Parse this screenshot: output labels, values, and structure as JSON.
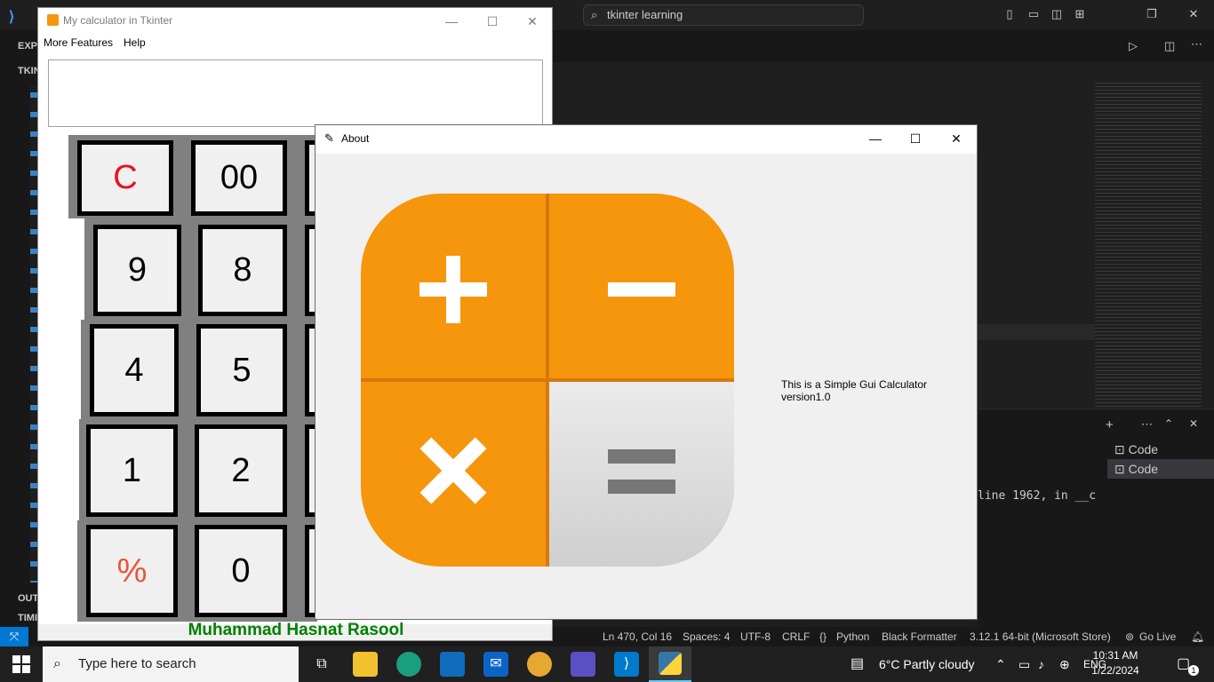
{
  "vscode": {
    "search_text": "tkinter learning",
    "sidebar_labels": [
      "EXPL",
      "TKIN",
      "OUT",
      "TIMI"
    ],
    "panel_line": "line 1962, in __c",
    "terminals": [
      "Code",
      "Code"
    ],
    "status": {
      "position": "Ln 470, Col 16",
      "spaces": "Spaces: 4",
      "encoding": "UTF-8",
      "eol": "CRLF",
      "language": "Python",
      "formatter": "Black Formatter",
      "interpreter": "3.12.1 64-bit (Microsoft Store)",
      "golive": "Go Live"
    }
  },
  "calc": {
    "title": "My calculator in Tkinter",
    "menu": [
      "More Features",
      "Help"
    ],
    "buttons": {
      "clear": "C",
      "double_zero": "00",
      "nine": "9",
      "eight": "8",
      "four": "4",
      "five": "5",
      "one": "1",
      "two": "2",
      "percent": "%",
      "zero": "0"
    },
    "author": "Muhammad Hasnat Rasool",
    "clear_color": "#e81123",
    "percent_color": "#e8553a"
  },
  "about": {
    "title": "About",
    "text": "This is a Simple Gui Calculator version1.0",
    "icon_color": "#f5960c"
  },
  "taskbar": {
    "search_placeholder": "Type here to search",
    "weather": "6°C  Partly cloudy",
    "lang": "ENG",
    "time": "10:31 AM",
    "date": "1/22/2024",
    "notifications": "1"
  }
}
